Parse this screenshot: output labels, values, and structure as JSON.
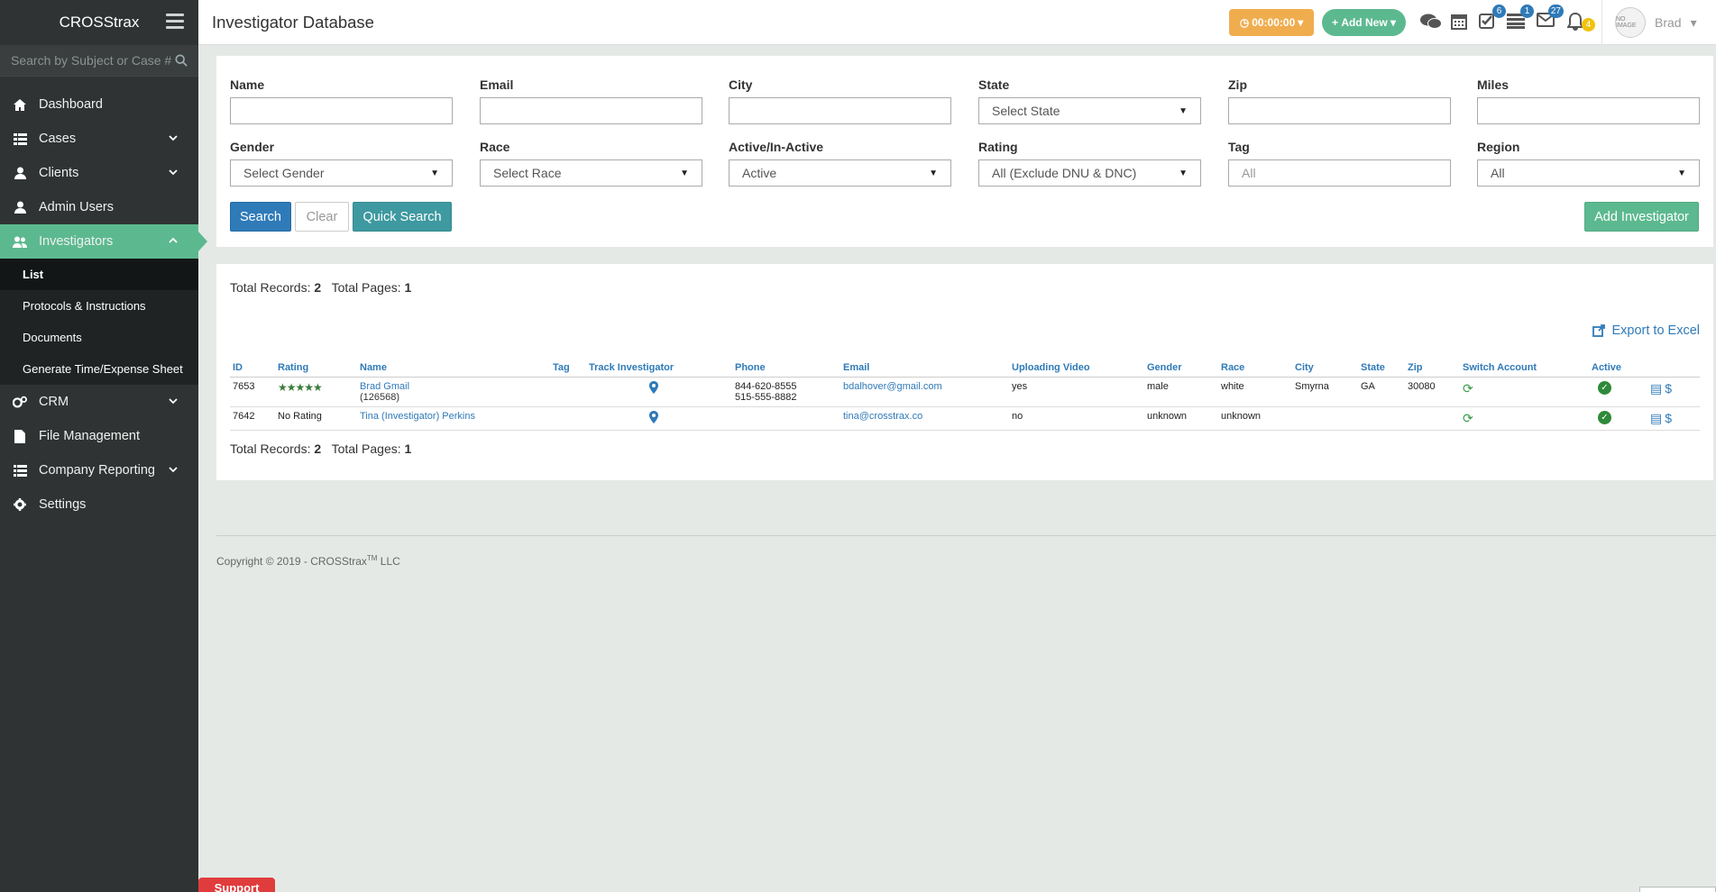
{
  "sidebar": {
    "brand": "CROSStrax",
    "search_placeholder": "Search by Subject or Case #",
    "items": [
      {
        "label": "Dashboard"
      },
      {
        "label": "Cases"
      },
      {
        "label": "Clients"
      },
      {
        "label": "Admin Users"
      },
      {
        "label": "Investigators"
      },
      {
        "label": "CRM"
      },
      {
        "label": "File Management"
      },
      {
        "label": "Company Reporting"
      },
      {
        "label": "Settings"
      }
    ],
    "sub_items": [
      {
        "label": "List"
      },
      {
        "label": "Protocols & Instructions"
      },
      {
        "label": "Documents"
      },
      {
        "label": "Generate Time/Expense Sheet"
      }
    ]
  },
  "header": {
    "title": "Investigator Database",
    "timer": "00:00:00",
    "add_new": "Add New",
    "badges": {
      "tasks": "6",
      "list": "1",
      "mail": "27",
      "alerts": "4"
    },
    "user": "Brad",
    "avatar_text": "NO IMAGE"
  },
  "filters": {
    "name": {
      "label": "Name",
      "value": ""
    },
    "email": {
      "label": "Email",
      "value": ""
    },
    "city": {
      "label": "City",
      "value": ""
    },
    "state": {
      "label": "State",
      "value": "Select State"
    },
    "zip": {
      "label": "Zip",
      "value": ""
    },
    "miles": {
      "label": "Miles",
      "value": ""
    },
    "gender": {
      "label": "Gender",
      "value": "Select Gender"
    },
    "race": {
      "label": "Race",
      "value": "Select Race"
    },
    "active": {
      "label": "Active/In-Active",
      "value": "Active"
    },
    "rating": {
      "label": "Rating",
      "value": "All (Exclude DNU & DNC)"
    },
    "tag": {
      "label": "Tag",
      "placeholder": "All"
    },
    "region": {
      "label": "Region",
      "value": "All"
    },
    "search_btn": "Search",
    "clear_btn": "Clear",
    "quick_btn": "Quick Search",
    "add_btn": "Add Investigator"
  },
  "results": {
    "total_records_label": "Total Records:",
    "total_records": "2",
    "total_pages_label": "Total Pages:",
    "total_pages": "1",
    "export_label": "Export to Excel",
    "columns": [
      "ID",
      "Rating",
      "Name",
      "Tag",
      "Track Investigator",
      "Phone",
      "Email",
      "Uploading Video",
      "Gender",
      "Race",
      "City",
      "State",
      "Zip",
      "Switch Account",
      "Active",
      ""
    ],
    "rows": [
      {
        "id": "7653",
        "rating": "★★★★★",
        "name": "Brad Gmail",
        "name_sub": "(126568)",
        "tag": "",
        "phone1": "844-620-8555",
        "phone2": "515-555-8882",
        "email": "bdalhover@gmail.com",
        "video": "yes",
        "gender": "male",
        "race": "white",
        "city": "Smyrna",
        "state": "GA",
        "zip": "30080"
      },
      {
        "id": "7642",
        "rating": "No Rating",
        "name": "Tina (Investigator) Perkins",
        "name_sub": "",
        "tag": "",
        "phone1": "",
        "phone2": "",
        "email": "tina@crosstrax.co",
        "video": "no",
        "gender": "unknown",
        "race": "unknown",
        "city": "",
        "state": "",
        "zip": ""
      }
    ]
  },
  "footer": {
    "copyright": "Copyright © 2019 - CROSStrax",
    "tm": "TM",
    "llc": " LLC"
  },
  "support": "Support"
}
